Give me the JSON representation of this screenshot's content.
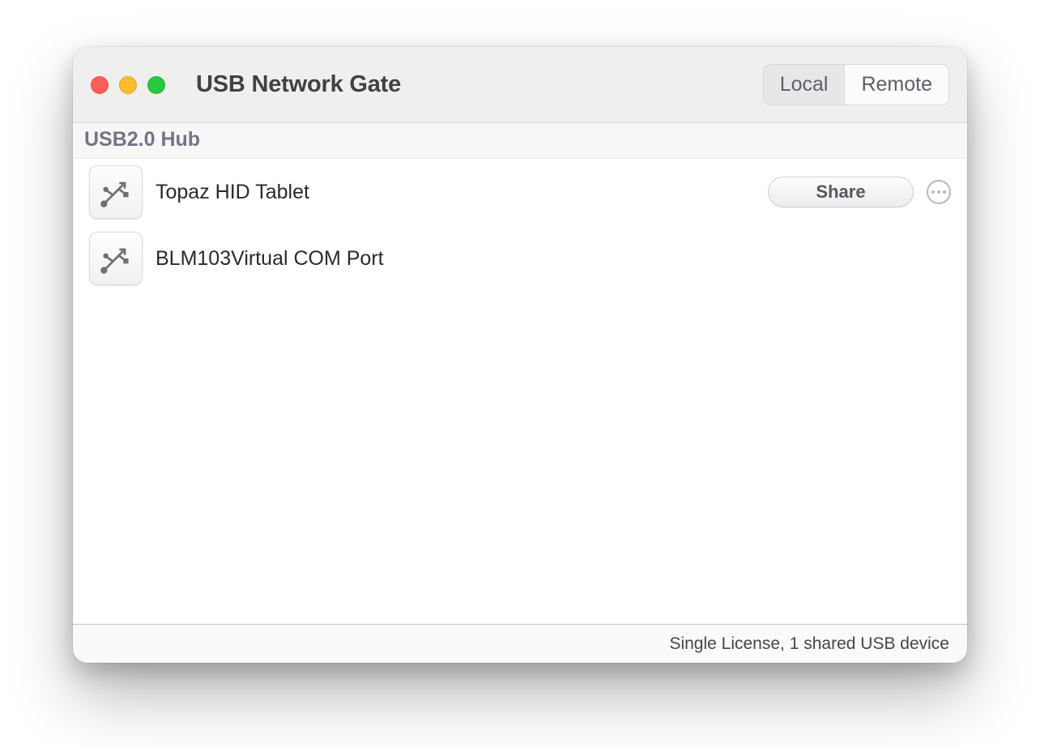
{
  "window": {
    "title": "USB Network Gate"
  },
  "tabs": {
    "local": "Local",
    "remote": "Remote",
    "active": "Local"
  },
  "section": {
    "title": "USB2.0 Hub"
  },
  "devices": [
    {
      "name": "Topaz HID Tablet",
      "icon": "usb-icon",
      "share_label": "Share",
      "show_actions": true
    },
    {
      "name": "BLM103Virtual COM Port",
      "icon": "usb-icon",
      "show_actions": false
    }
  ],
  "status": {
    "text": "Single License, 1 shared USB device"
  }
}
